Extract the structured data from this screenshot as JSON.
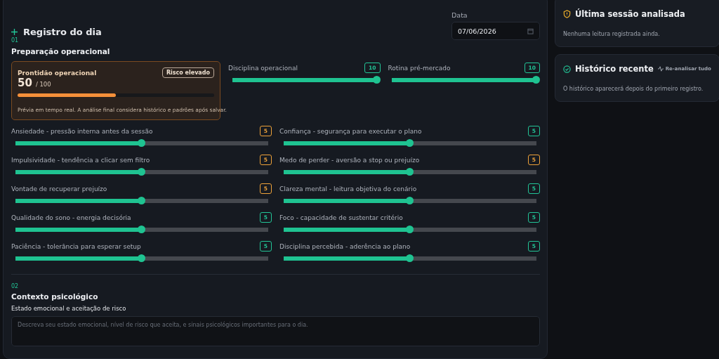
{
  "form": {
    "title": "Registro do dia",
    "date": {
      "label": "Data",
      "value": "07/06/2026"
    },
    "section_1": {
      "number": "01",
      "title": "Preparação operacional",
      "readiness": {
        "title": "Prontidão operacional",
        "badge": "Risco elevado",
        "score": "50",
        "max": "/ 100",
        "level": 0.5,
        "note": "Prévia em tempo real. A análise final considera histórico e padrões após salvar."
      },
      "top_sliders": [
        {
          "label": "Disciplina operacional",
          "value": "10",
          "color": "#22c597",
          "level": 1
        },
        {
          "label": "Rotina pré-mercado",
          "value": "10",
          "color": "#22c597",
          "level": 1
        }
      ],
      "sliders": [
        {
          "label": "Ansiedade - pressão interna antes da sessão",
          "value": "5",
          "color": "#eea23a",
          "level": 0.5
        },
        {
          "label": "Confiança - segurança para executar o plano",
          "value": "5",
          "color": "#22c597",
          "level": 0.5
        },
        {
          "label": "Impulsividade - tendência a clicar sem filtro",
          "value": "5",
          "color": "#eea23a",
          "level": 0.5
        },
        {
          "label": "Medo de perder - aversão a stop ou prejuízo",
          "value": "5",
          "color": "#eea23a",
          "level": 0.5
        },
        {
          "label": "Vontade de recuperar prejuízo",
          "value": "5",
          "color": "#eea23a",
          "level": 0.5
        },
        {
          "label": "Clareza mental - leitura objetiva do cenário",
          "value": "5",
          "color": "#22c597",
          "level": 0.5
        },
        {
          "label": "Qualidade do sono - energia decisória",
          "value": "5",
          "color": "#22c597",
          "level": 0.5
        },
        {
          "label": "Foco - capacidade de sustentar critério",
          "value": "5",
          "color": "#22c597",
          "level": 0.5
        },
        {
          "label": "Paciência - tolerância para esperar setup",
          "value": "5",
          "color": "#22c597",
          "level": 0.5
        },
        {
          "label": "Disciplina percebida - aderência ao plano",
          "value": "5",
          "color": "#22c597",
          "level": 0.5
        }
      ]
    },
    "section_2": {
      "number": "02",
      "title": "Contexto psicológico",
      "field_label": "Estado emocional e aceitação de risco",
      "placeholder": "Descreva seu estado emocional, nível de risco que aceita, e sinais psicológicos importantes para o dia."
    }
  },
  "sidebar": {
    "last_session": {
      "title": "Última sessão analisada",
      "text": "Nenhuma leitura registrada ainda."
    },
    "history": {
      "title": "Histórico recente",
      "action": "Re-analisar tudo",
      "text": "O histórico aparecerá depois do primeiro registro."
    }
  }
}
